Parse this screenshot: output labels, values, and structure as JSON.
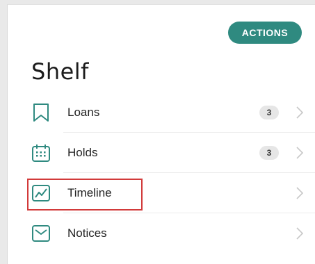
{
  "header": {
    "actions_label": "ACTIONS",
    "title": "Shelf"
  },
  "colors": {
    "accent": "#2f8a80",
    "highlight": "#d23a3a",
    "badge_bg": "#e6e6e6"
  },
  "shelf_items": [
    {
      "label": "Loans",
      "icon": "bookmark-icon",
      "badge": "3"
    },
    {
      "label": "Holds",
      "icon": "calendar-icon",
      "badge": "3"
    },
    {
      "label": "Timeline",
      "icon": "chart-line-icon",
      "badge": null,
      "highlighted": true
    },
    {
      "label": "Notices",
      "icon": "envelope-icon",
      "badge": null
    }
  ]
}
